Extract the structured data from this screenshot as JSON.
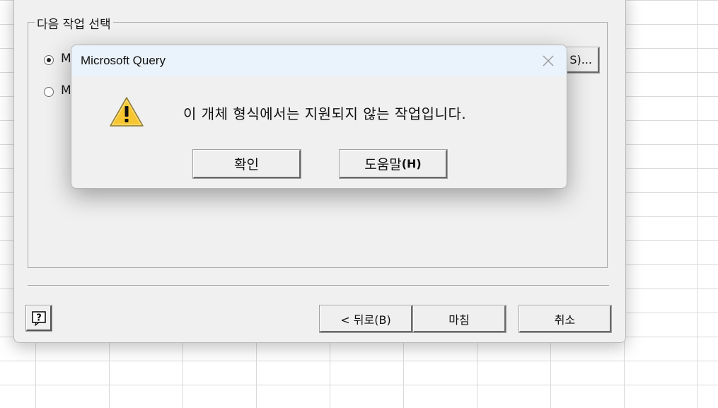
{
  "wizard": {
    "group_label": "다음 작업 선택",
    "option1_label": "M",
    "option2_label": "M",
    "partial_button_label": "S)...",
    "back_button": "< 뒤로(B)",
    "finish_button": "마침",
    "cancel_button": "취소"
  },
  "msgbox": {
    "title": "Microsoft Query",
    "message": "이 개체 형식에서는 지원되지 않는 작업입니다.",
    "ok_button": "확인",
    "help_button": "도움말",
    "help_accel": "(H)"
  },
  "icons": {
    "warning": "warning-icon",
    "close": "close-icon",
    "help": "help-icon"
  },
  "colors": {
    "titlebar": "#eaf2fb",
    "dialog_bg": "#f0f0f0",
    "warning_yellow": "#f6c631"
  }
}
